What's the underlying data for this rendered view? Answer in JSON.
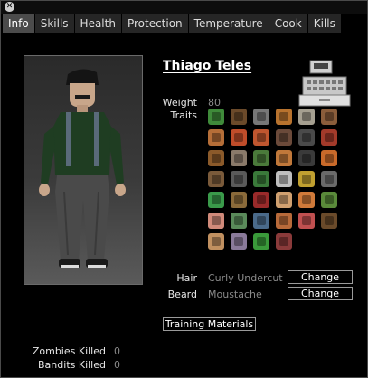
{
  "tabs": [
    {
      "label": "Info"
    },
    {
      "label": "Skills"
    },
    {
      "label": "Health"
    },
    {
      "label": "Protection"
    },
    {
      "label": "Temperature"
    },
    {
      "label": "Cook"
    },
    {
      "label": "Kills"
    }
  ],
  "character": {
    "name": "Thiago Teles",
    "weight_label": "Weight",
    "weight_value": "80",
    "traits_label": "Traits",
    "hair_label": "Hair",
    "hair_value": "Curly Undercut",
    "beard_label": "Beard",
    "beard_value": "Moustache",
    "change_label": "Change",
    "training_label": "Training Materials"
  },
  "kills": {
    "zombies_label": "Zombies Killed",
    "zombies_value": "0",
    "bandits_label": "Bandits Killed",
    "bandits_value": "0"
  },
  "traits": [
    {
      "icon": "sewing-icon",
      "color": "#3f8a3a"
    },
    {
      "icon": "hunter-icon",
      "color": "#6b4a2a"
    },
    {
      "icon": "chess-icon",
      "color": "#777777"
    },
    {
      "icon": "dumbbell-icon",
      "color": "#b8732e"
    },
    {
      "icon": "brain-icon",
      "color": "#a59f90"
    },
    {
      "icon": "tool-icon",
      "color": "#8a5d3b"
    },
    {
      "icon": "shield-icon",
      "color": "#b56e38"
    },
    {
      "icon": "stomach-icon",
      "color": "#c04d2a"
    },
    {
      "icon": "fist-icon",
      "color": "#c0562f"
    },
    {
      "icon": "boot-icon",
      "color": "#6b4a3a"
    },
    {
      "icon": "brain-icon",
      "color": "#4a4a4a"
    },
    {
      "icon": "shirt-icon",
      "color": "#a33a2a"
    },
    {
      "icon": "bat-icon",
      "color": "#8b5a2a"
    },
    {
      "icon": "horse-icon",
      "color": "#8a7a6a"
    },
    {
      "icon": "fishing-icon",
      "color": "#4a7a3a"
    },
    {
      "icon": "burger-icon",
      "color": "#c0783a"
    },
    {
      "icon": "head-icon",
      "color": "#3a3a3a"
    },
    {
      "icon": "pan-icon",
      "color": "#c96a2a"
    },
    {
      "icon": "eagle-icon",
      "color": "#7a5a3a"
    },
    {
      "icon": "axe-icon",
      "color": "#5a5a5a"
    },
    {
      "icon": "cap-icon",
      "color": "#3a7a3a"
    },
    {
      "icon": "eye-icon",
      "color": "#bfbfbf"
    },
    {
      "icon": "coil-icon",
      "color": "#c0a030"
    },
    {
      "icon": "knife-icon",
      "color": "#6a6a6a"
    },
    {
      "icon": "medical-icon",
      "color": "#3a9a4a"
    },
    {
      "icon": "wheel-icon",
      "color": "#8a6a3a"
    },
    {
      "icon": "heart-icon",
      "color": "#9a2a2a"
    },
    {
      "icon": "bandage-icon",
      "color": "#d0a070"
    },
    {
      "icon": "avatar-icon",
      "color": "#d07a3a"
    },
    {
      "icon": "needle-icon",
      "color": "#5a8a3a"
    },
    {
      "icon": "brain-icon",
      "color": "#d08a7a"
    },
    {
      "icon": "mountain-icon",
      "color": "#5a8a5a"
    },
    {
      "icon": "flask-icon",
      "color": "#4a6a8a"
    },
    {
      "icon": "arm-icon",
      "color": "#b86a3a"
    },
    {
      "icon": "lungs-icon",
      "color": "#c05050"
    },
    {
      "icon": "gun-icon",
      "color": "#6a4a2a"
    },
    {
      "icon": "ears-icon",
      "color": "#c09060"
    },
    {
      "icon": "figure-icon",
      "color": "#8a7a9a"
    },
    {
      "icon": "plant-icon",
      "color": "#3a9a3a"
    },
    {
      "icon": "no-icon",
      "color": "#8a3a3a"
    }
  ]
}
